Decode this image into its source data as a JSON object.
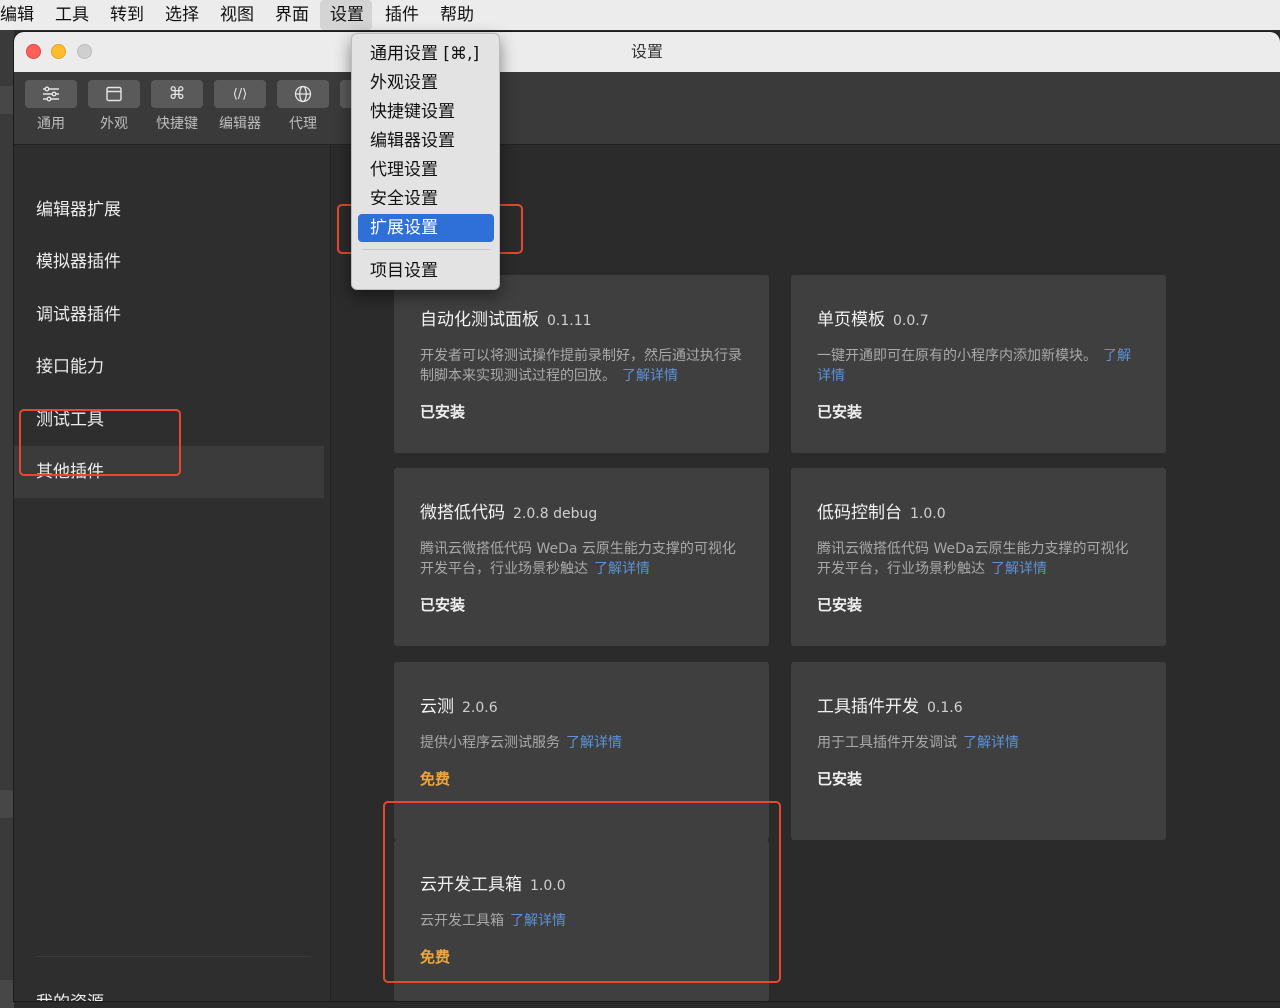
{
  "menubar": {
    "items": [
      "编辑",
      "工具",
      "转到",
      "选择",
      "视图",
      "界面",
      "设置",
      "插件",
      "帮助"
    ],
    "active_index": 6
  },
  "window": {
    "title": "设置"
  },
  "toolbar": {
    "buttons": [
      {
        "label": "通用",
        "icon": "sliders-icon"
      },
      {
        "label": "外观",
        "icon": "layout-icon"
      },
      {
        "label": "快捷键",
        "icon": "command-key-icon"
      },
      {
        "label": "编辑器",
        "icon": "code-icon"
      },
      {
        "label": "代理",
        "icon": "globe-icon"
      }
    ]
  },
  "sidebar": {
    "items": [
      "编辑器扩展",
      "模拟器插件",
      "调试器插件",
      "接口能力",
      "测试工具",
      "其他插件"
    ],
    "selected_index": 5,
    "footer": "我的资源"
  },
  "dropdown": {
    "items": [
      "通用设置 [⌘,]",
      "外观设置",
      "快捷键设置",
      "编辑器设置",
      "代理设置",
      "安全设置",
      "扩展设置",
      "项目设置"
    ],
    "selected_index": 6
  },
  "cards": [
    {
      "title": "自动化测试面板",
      "version": "0.1.11",
      "desc": "开发者可以将测试操作提前录制好，然后通过执行录制脚本来实现测试过程的回放。",
      "link": "了解详情",
      "status": "已安装",
      "free": false
    },
    {
      "title": "单页模板",
      "version": "0.0.7",
      "desc": "一键开通即可在原有的小程序内添加新模块。",
      "link": "了解详情",
      "status": "已安装",
      "free": false
    },
    {
      "title": "微搭低代码",
      "version": "2.0.8 debug",
      "desc": "腾讯云微搭低代码 WeDa 云原生能力支撑的可视化开发平台，行业场景秒触达",
      "link": "了解详情",
      "status": "已安装",
      "free": false
    },
    {
      "title": "低码控制台",
      "version": "1.0.0",
      "desc": "腾讯云微搭低代码 WeDa云原生能力支撑的可视化开发平台，行业场景秒触达",
      "link": "了解详情",
      "status": "已安装",
      "free": false
    },
    {
      "title": "云测",
      "version": "2.0.6",
      "desc": "提供小程序云测试服务",
      "link": "了解详情",
      "status": "免费",
      "free": true
    },
    {
      "title": "工具插件开发",
      "version": "0.1.6",
      "desc": "用于工具插件开发调试",
      "link": "了解详情",
      "status": "已安装",
      "free": false
    },
    {
      "title": "云开发工具箱",
      "version": "1.0.0",
      "desc": "云开发工具箱",
      "link": "了解详情",
      "status": "免费",
      "free": true
    }
  ],
  "colors": {
    "accent": "#2f6fd8",
    "highlight_box": "#e5482a",
    "free_text": "#f0a53a",
    "link": "#5b92d6",
    "card_bg": "#3f3f3f"
  }
}
